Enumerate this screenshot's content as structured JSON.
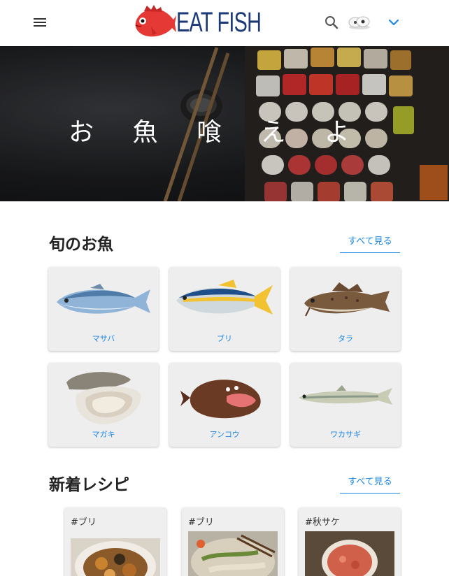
{
  "header": {
    "logo_text": "EAT FISH",
    "icons": [
      "menu-icon",
      "search-icon",
      "avatar",
      "chevron-down-icon"
    ]
  },
  "hero": {
    "title": "お 魚 喰 え よ"
  },
  "seasonal": {
    "title": "旬のお魚",
    "see_all": "すべて見る",
    "items": [
      {
        "label": "マサバ"
      },
      {
        "label": "ブリ"
      },
      {
        "label": "タラ"
      },
      {
        "label": "マガキ"
      },
      {
        "label": "アンコウ"
      },
      {
        "label": "ワカサギ"
      }
    ]
  },
  "recipes": {
    "title": "新着レシピ",
    "see_all": "すべて見る",
    "items": [
      {
        "tag": "#ブリ"
      },
      {
        "tag": "#ブリ"
      },
      {
        "tag": "#秋サケ"
      }
    ]
  },
  "colors": {
    "accent": "#1e88e5",
    "logo": "#1c3a78"
  }
}
